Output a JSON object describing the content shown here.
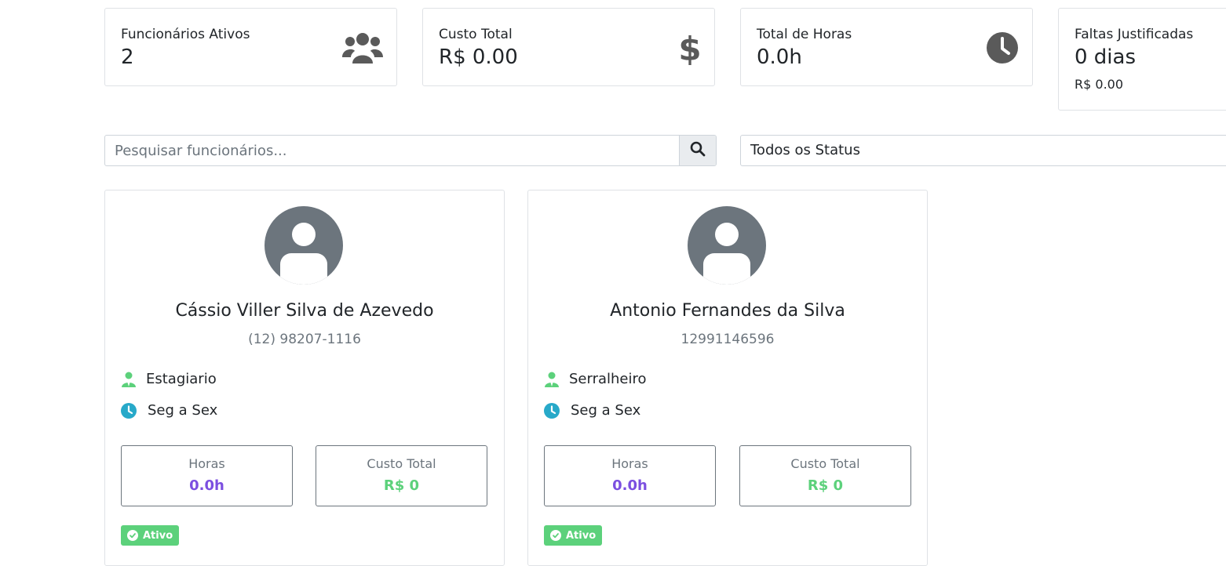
{
  "stats": [
    {
      "label": "Funcionários Ativos",
      "value": "2",
      "icon": "users-icon"
    },
    {
      "label": "Custo Total",
      "value": "R$ 0.00",
      "icon": "dollar-icon"
    },
    {
      "label": "Total de Horas",
      "value": "0.0h",
      "icon": "clock-icon"
    },
    {
      "label": "Faltas Justificadas",
      "value": "0 dias",
      "sub": "R$ 0.00"
    }
  ],
  "search": {
    "placeholder": "Pesquisar funcionários...",
    "value": ""
  },
  "status_filter": {
    "selected": "Todos os Status"
  },
  "employees": [
    {
      "name": "Cássio Viller Silva de Azevedo",
      "phone": "(12) 98207-1116",
      "role": "Estagiario",
      "schedule": "Seg a Sex",
      "hours_label": "Horas",
      "hours_value": "0.0h",
      "cost_label": "Custo Total",
      "cost_value": "R$ 0",
      "status": "Ativo"
    },
    {
      "name": "Antonio Fernandes da Silva",
      "phone": "12991146596",
      "role": "Serralheiro",
      "schedule": "Seg a Sex",
      "hours_label": "Horas",
      "hours_value": "0.0h",
      "cost_label": "Custo Total",
      "cost_value": "R$ 0",
      "status": "Ativo"
    }
  ],
  "colors": {
    "hours": "#7b4fe0",
    "cost": "#5cd17b",
    "status_active": "#5cd17b",
    "role_icon": "#5cd17b",
    "schedule_icon": "#27a9c9",
    "stat_icon": "#5a5a5a",
    "avatar": "#6c757d"
  }
}
